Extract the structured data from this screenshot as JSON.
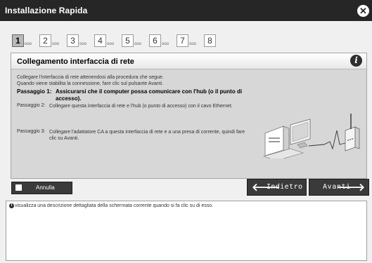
{
  "window": {
    "title": "Installazione Rapida",
    "close_glyph": "✕"
  },
  "steps": [
    {
      "number": "1",
      "dots": "ooo",
      "active": true
    },
    {
      "number": "2",
      "dots": "ooo",
      "active": false
    },
    {
      "number": "3",
      "dots": "ooo",
      "active": false
    },
    {
      "number": "4",
      "dots": "ooo",
      "active": false
    },
    {
      "number": "5",
      "dots": "ooo",
      "active": false
    },
    {
      "number": "6",
      "dots": "ooo",
      "active": false
    },
    {
      "number": "7",
      "dots": "ooo",
      "active": false
    },
    {
      "number": "8",
      "dots": "",
      "active": false
    }
  ],
  "panel": {
    "title": "Collegamento interfaccia di rete",
    "info_glyph": "i",
    "intro_line1": "Collegare l'interfaccia di rete attenendosi alla procedura che segue.",
    "intro_line2": "Quando viene stabilita la connessione, fare clic sul pulsante Avanti.",
    "step1_label": "Passaggio 1:",
    "step1_text": "Assicurarsi che il computer possa comunicare con l'hub (o il punto di accesso).",
    "step2_label": "Passaggio 2:",
    "step2_text": "Collegare questa interfaccia di rete e l'hub (o punto di accesso) con il cavo Ethernet.",
    "step3_label": "Passaggio 3:",
    "step3_text": "Collegare l'adattatore CA a questa interfaccia di rete e a una presa di corrente, quindi fare clic su Avanti."
  },
  "buttons": {
    "cancel": "Annulla",
    "back": "Indietro",
    "next": "Avanti",
    "back_arrow": "🡐",
    "next_arrow": "🡒"
  },
  "help": {
    "icon_glyph": "i",
    "text": "visualizza una descrizione dettagliata della schermata corrente quando si fa clic su di esso."
  },
  "colors": {
    "titlebar": "#262626",
    "panel": "#d7d7d7",
    "button": "#3a3a3a"
  }
}
